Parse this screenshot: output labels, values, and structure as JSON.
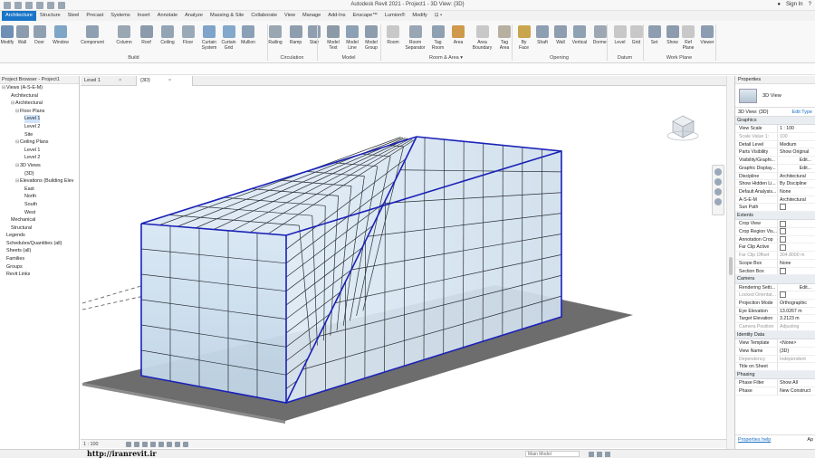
{
  "titlebar": {
    "window_title": "Autodesk Revit 2021 - Project1 - 3D View: {3D}",
    "sign_in": "Sign In"
  },
  "ribbon_tabs": [
    "Architecture",
    "Structure",
    "Steel",
    "Precast",
    "Systems",
    "Insert",
    "Annotate",
    "Analyze",
    "Massing & Site",
    "Collaborate",
    "View",
    "Manage",
    "Add-Ins",
    "Enscape™",
    "Lumion®",
    "Modify",
    "⊡ •"
  ],
  "ribbon": {
    "tools": [
      {
        "label": "Modify",
        "color": "#6f8fb4"
      },
      {
        "label": "Wall",
        "color": "#8a9cad"
      },
      {
        "label": "Door",
        "color": "#8fa0b0"
      },
      {
        "label": "Window",
        "color": "#7fa6c7"
      },
      {
        "label": "Component",
        "color": "#8ea0b2"
      },
      {
        "label": "Column",
        "color": "#9aa7b3"
      },
      {
        "label": "Roof",
        "color": "#8c9bab"
      },
      {
        "label": "Ceiling",
        "color": "#93a4b5"
      },
      {
        "label": "Floor",
        "color": "#9aa9b8"
      },
      {
        "label": "Curtain\nSystem",
        "color": "#7ea4c9"
      },
      {
        "label": "Curtain\nGrid",
        "color": "#84a8cb"
      },
      {
        "label": "Mullion",
        "color": "#8aa0b7"
      },
      {
        "label": "Railing",
        "color": "#9aa6b2"
      },
      {
        "label": "Ramp",
        "color": "#8e9eae"
      },
      {
        "label": "Stair",
        "color": "#8f9fb0"
      },
      {
        "label": "Model\nText",
        "color": "#8c9aa8"
      },
      {
        "label": "Model\nLine",
        "color": "#8da1b5"
      },
      {
        "label": "Model\nGroup",
        "color": "#8d9dae"
      },
      {
        "label": "Room",
        "color": "#c8c8c8"
      },
      {
        "label": "Room\nSeparator",
        "color": "#9aa6b3"
      },
      {
        "label": "Tag\nRoom",
        "color": "#8fa0b1"
      },
      {
        "label": "Area",
        "color": "#d09a4c"
      },
      {
        "label": "Area\nBoundary",
        "color": "#c8c8c8"
      },
      {
        "label": "Tag\nArea",
        "color": "#b7b0a0"
      },
      {
        "label": "By\nFace",
        "color": "#c9a64d"
      },
      {
        "label": "Shaft",
        "color": "#8d9fb2"
      },
      {
        "label": "Wall",
        "color": "#8e9db0"
      },
      {
        "label": "Vertical",
        "color": "#8fa2b4"
      },
      {
        "label": "Dormer",
        "color": "#9ea8b4"
      },
      {
        "label": "Level",
        "color": "#c8c8c8"
      },
      {
        "label": "Grid",
        "color": "#c8c8c8"
      },
      {
        "label": "Set",
        "color": "#8e9eb0"
      },
      {
        "label": "Show",
        "color": "#8c9cae"
      },
      {
        "label": "Ref\nPlane",
        "color": "#c8c8c8"
      },
      {
        "label": "Viewer",
        "color": "#8d9db1"
      }
    ],
    "panels": [
      "Build",
      "Circulation",
      "Model",
      "Room & Area ▾",
      "Opening",
      "Datum",
      "Work Plane"
    ]
  },
  "project_browser": {
    "header": "Project Browser - Project1",
    "nodes": [
      {
        "label": "Views (A-S-E-M)",
        "indent": 0,
        "toggle": "⊟"
      },
      {
        "label": "Architectural",
        "indent": 1,
        "toggle": ""
      },
      {
        "label": "Architectural",
        "indent": 2,
        "toggle": "⊟"
      },
      {
        "label": "Floor Plans",
        "indent": 3,
        "toggle": "⊟"
      },
      {
        "label": "Level 1",
        "indent": 4,
        "toggle": "",
        "selected": true
      },
      {
        "label": "Level 2",
        "indent": 4,
        "toggle": ""
      },
      {
        "label": "Site",
        "indent": 4,
        "toggle": ""
      },
      {
        "label": "Ceiling Plans",
        "indent": 3,
        "toggle": "⊟"
      },
      {
        "label": "Level 1",
        "indent": 4,
        "toggle": ""
      },
      {
        "label": "Level 2",
        "indent": 4,
        "toggle": ""
      },
      {
        "label": "3D Views",
        "indent": 3,
        "toggle": "⊟"
      },
      {
        "label": "{3D}",
        "indent": 4,
        "toggle": ""
      },
      {
        "label": "Elevations (Building Elev",
        "indent": 3,
        "toggle": "⊟"
      },
      {
        "label": "East",
        "indent": 4,
        "toggle": ""
      },
      {
        "label": "North",
        "indent": 4,
        "toggle": ""
      },
      {
        "label": "South",
        "indent": 4,
        "toggle": ""
      },
      {
        "label": "West",
        "indent": 4,
        "toggle": ""
      },
      {
        "label": "Mechanical",
        "indent": 1,
        "toggle": ""
      },
      {
        "label": "Structural",
        "indent": 1,
        "toggle": ""
      },
      {
        "label": "Legends",
        "indent": 0,
        "toggle": ""
      },
      {
        "label": "Schedules/Quantities (all)",
        "indent": 0,
        "toggle": ""
      },
      {
        "label": "Sheets (all)",
        "indent": 0,
        "toggle": ""
      },
      {
        "label": "Families",
        "indent": 0,
        "toggle": ""
      },
      {
        "label": "Groups",
        "indent": 0,
        "toggle": ""
      },
      {
        "label": "Revit Links",
        "indent": 0,
        "toggle": ""
      }
    ]
  },
  "view_tabs": [
    {
      "label": "Level 1",
      "close": "×"
    },
    {
      "label": "{3D}",
      "close": "×",
      "active": true
    }
  ],
  "view_control_bar": {
    "scale": "1 : 100"
  },
  "properties": {
    "header": "Properties",
    "type_name": "3D View",
    "view_selector": "3D View: {3D}",
    "edit_type": "Edit Type",
    "groups": [
      {
        "name": "Graphics",
        "rows": [
          {
            "k": "View Scale",
            "v": "1 : 100"
          },
          {
            "k": "Scale Value    1:",
            "v": "100",
            "dim": true
          },
          {
            "k": "Detail Level",
            "v": "Medium"
          },
          {
            "k": "Parts Visibility",
            "v": "Show Original"
          },
          {
            "k": "Visibility/Graphi...",
            "v": "Edit...",
            "btn": true
          },
          {
            "k": "Graphic Display...",
            "v": "Edit...",
            "btn": true
          },
          {
            "k": "Discipline",
            "v": "Architectural"
          },
          {
            "k": "Show Hidden Li...",
            "v": "By Discipline"
          },
          {
            "k": "Default Analysis...",
            "v": "None"
          },
          {
            "k": "A-S-E-M",
            "v": "Architectural"
          },
          {
            "k": "Sun Path",
            "v": "",
            "cb": true
          }
        ]
      },
      {
        "name": "Extents",
        "rows": [
          {
            "k": "Crop View",
            "v": "",
            "cb": true
          },
          {
            "k": "Crop Region Vis...",
            "v": "",
            "cb": true
          },
          {
            "k": "Annotation Crop",
            "v": "",
            "cb": true
          },
          {
            "k": "Far Clip Active",
            "v": "",
            "cb": true
          },
          {
            "k": "Far Clip Offset",
            "v": "304.8000 m",
            "dim": true
          },
          {
            "k": "Scope Box",
            "v": "None"
          },
          {
            "k": "Section Box",
            "v": "",
            "cb": true
          }
        ]
      },
      {
        "name": "Camera",
        "rows": [
          {
            "k": "Rendering Setti...",
            "v": "Edit...",
            "btn": true
          },
          {
            "k": "Locked Orientat...",
            "v": "",
            "dim": true,
            "cb": true
          },
          {
            "k": "Projection Mode",
            "v": "Orthographic"
          },
          {
            "k": "Eye Elevation",
            "v": "13.0267 m"
          },
          {
            "k": "Target Elevation",
            "v": "3.2123 m"
          },
          {
            "k": "Camera Position",
            "v": "Adjusting",
            "dim": true
          }
        ]
      },
      {
        "name": "Identity Data",
        "rows": [
          {
            "k": "View Template",
            "v": "<None>"
          },
          {
            "k": "View Name",
            "v": "{3D}"
          },
          {
            "k": "Dependency",
            "v": "Independent",
            "dim": true
          },
          {
            "k": "Title on Sheet",
            "v": ""
          }
        ]
      },
      {
        "name": "Phasing",
        "rows": [
          {
            "k": "Phase Filter",
            "v": "Show All"
          },
          {
            "k": "Phase",
            "v": "New Construct"
          }
        ]
      }
    ],
    "help_link": "Properties help",
    "apply": "Ap"
  },
  "status_bar": {
    "watermark": "http://iranrevit.ir",
    "model_selector": "Main Model"
  },
  "colors": {
    "accent": "#1a75c8",
    "curtain_edge": "#1b22b8",
    "glass": "#c9dced",
    "slab": "#6a6a6a"
  }
}
